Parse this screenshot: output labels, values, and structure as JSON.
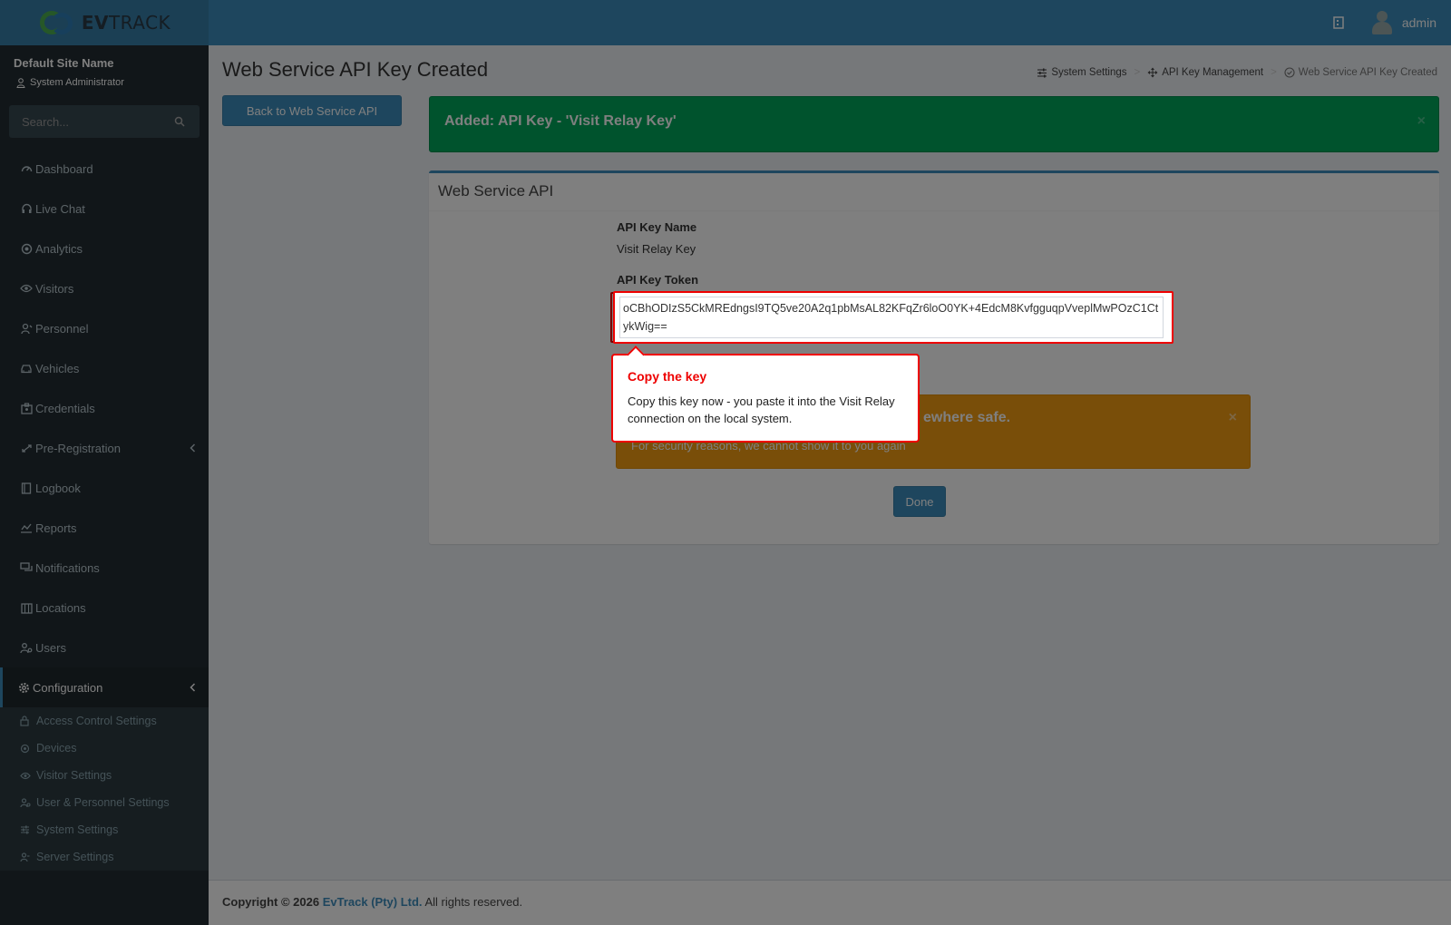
{
  "header": {
    "logo_text_bold": "EV",
    "logo_text": "TRACK",
    "user_name": "admin"
  },
  "sidebar": {
    "site_name": "Default Site Name",
    "role": "System Administrator",
    "search_placeholder": "Search...",
    "items": [
      {
        "label": "Dashboard",
        "icon": "dashboard-icon"
      },
      {
        "label": "Live Chat",
        "icon": "headset-icon"
      },
      {
        "label": "Analytics",
        "icon": "target-icon"
      },
      {
        "label": "Visitors",
        "icon": "eye-icon"
      },
      {
        "label": "Personnel",
        "icon": "person-icon"
      },
      {
        "label": "Vehicles",
        "icon": "car-icon"
      },
      {
        "label": "Credentials",
        "icon": "id-card-icon"
      },
      {
        "label": "Pre-Registration",
        "icon": "arrows-icon"
      },
      {
        "label": "Logbook",
        "icon": "book-icon"
      },
      {
        "label": "Reports",
        "icon": "chart-icon"
      },
      {
        "label": "Notifications",
        "icon": "chat-icon"
      },
      {
        "label": "Locations",
        "icon": "map-icon"
      },
      {
        "label": "Users",
        "icon": "users-icon"
      },
      {
        "label": "Configuration",
        "icon": "gear-icon"
      }
    ],
    "subitems": [
      {
        "label": "Access Control Settings",
        "icon": "lock-icon"
      },
      {
        "label": "Devices",
        "icon": "devices-icon"
      },
      {
        "label": "Visitor Settings",
        "icon": "eye-icon"
      },
      {
        "label": "User & Personnel Settings",
        "icon": "user-gear-icon"
      },
      {
        "label": "System Settings",
        "icon": "sliders-icon"
      },
      {
        "label": "Server Settings",
        "icon": "server-icon"
      }
    ]
  },
  "page": {
    "title": "Web Service API Key Created",
    "breadcrumb": [
      "System Settings",
      "API Key Management",
      "Web Service API Key Created"
    ],
    "back_button": "Back to Web Service API",
    "success_alert": "Added: API Key - 'Visit Relay Key'",
    "close_glyph": "×",
    "box_title": "Web Service API",
    "api_key_name_label": "API Key Name",
    "api_key_name_value": "Visit Relay Key",
    "api_key_token_label": "API Key Token",
    "api_key_token_value": "oCBhODIzS5CkMREdngsI9TQ5ve20A2q1pbMsAL82KFqZr6loO0YK+4EdcM8KvfgguqpVveplMwPOzC1CtykWig==",
    "warning_title_visible": "ewhere safe.",
    "warning_sub": "For security reasons, we cannot show it to you again",
    "done_button": "Done"
  },
  "footer": {
    "copyright": "Copyright © 2026",
    "company": "EvTrack (Pty) Ltd.",
    "rights": "All rights reserved."
  },
  "tooltip": {
    "title": "Copy the key",
    "body": "Copy this key now - you paste it into the Visit Relay connection on the local system."
  },
  "colors": {
    "header": "#3c8dbc",
    "sidebar": "#222d32",
    "success": "#00a65a",
    "warning": "#f39c12",
    "highlight": "#ee0000"
  }
}
